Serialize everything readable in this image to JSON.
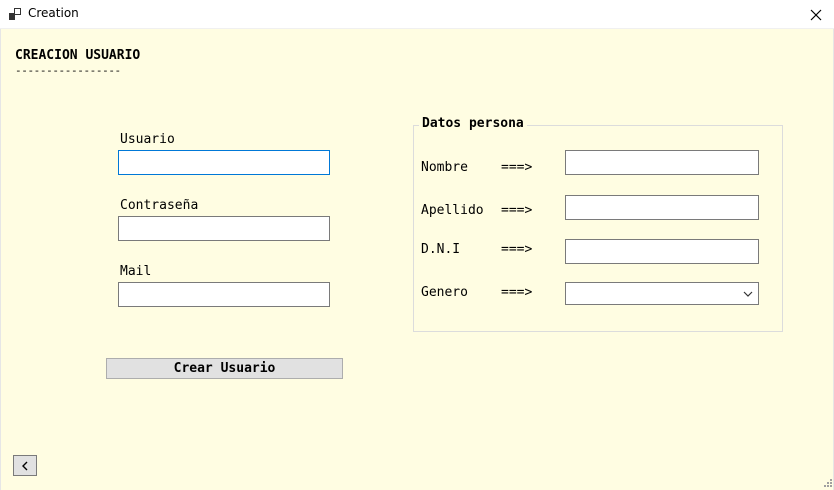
{
  "window": {
    "title": "Creation",
    "icon": "app-window-icon",
    "close_icon": "close-icon"
  },
  "form": {
    "heading": "CREACION USUARIO",
    "heading_underline": "-----------------",
    "usuario_label": "Usuario",
    "usuario_value": "",
    "contrasena_label": "Contraseña",
    "contrasena_value": "",
    "mail_label": "Mail",
    "mail_value": "",
    "create_button": "Crear Usuario"
  },
  "persona": {
    "group_title": "Datos persona",
    "arrow": "===>",
    "fields": {
      "nombre_label": "Nombre",
      "nombre_value": "",
      "apellido_label": "Apellido",
      "apellido_value": "",
      "dni_label": "D.N.I",
      "dni_value": "",
      "genero_label": "Genero",
      "genero_value": ""
    }
  },
  "back_button_icon": "chevron-left-icon",
  "colors": {
    "client_background": "#fffde2",
    "focus_border": "#0078d7",
    "button_face": "#e1e1e1"
  }
}
